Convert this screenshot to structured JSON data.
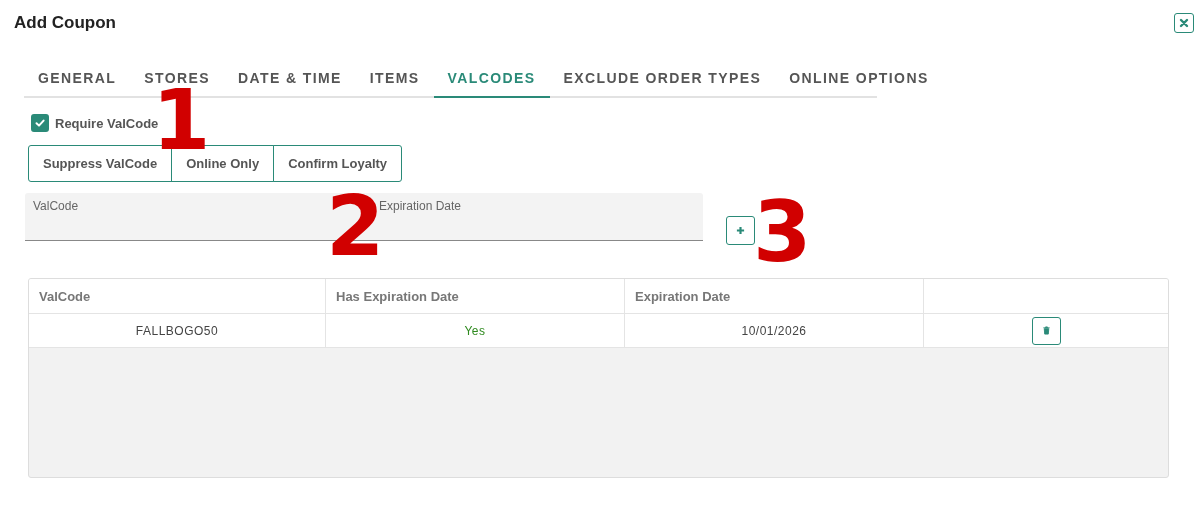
{
  "dialog": {
    "title": "Add Coupon"
  },
  "tabs": [
    {
      "label": "GENERAL",
      "selected": false
    },
    {
      "label": "STORES",
      "selected": false
    },
    {
      "label": "DATE & TIME",
      "selected": false
    },
    {
      "label": "ITEMS",
      "selected": false
    },
    {
      "label": "VALCODES",
      "selected": true
    },
    {
      "label": "EXCLUDE ORDER TYPES",
      "selected": false
    },
    {
      "label": "ONLINE OPTIONS",
      "selected": false
    }
  ],
  "require_valcode": {
    "label": "Require ValCode",
    "checked": true
  },
  "option_buttons": [
    "Suppress ValCode",
    "Online Only",
    "Confirm Loyalty"
  ],
  "fields": [
    {
      "placeholder": "ValCode"
    },
    {
      "placeholder": "Expiration Date"
    }
  ],
  "table": {
    "columns": [
      "ValCode",
      "Has Expiration Date",
      "Expiration Date"
    ],
    "rows": [
      {
        "valcode": "FALLBOGO50",
        "has_expiration": "Yes",
        "expiration_date": "10/01/2026"
      }
    ]
  },
  "annotations": [
    {
      "text": "1"
    },
    {
      "text": "2"
    },
    {
      "text": "3"
    }
  ]
}
